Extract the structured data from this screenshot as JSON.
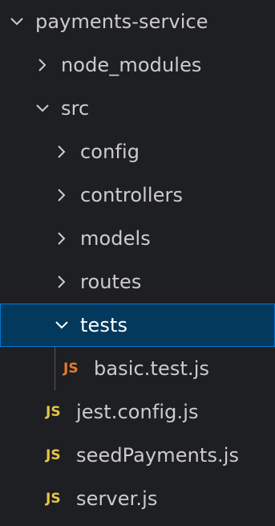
{
  "explorer": {
    "root": {
      "label": "payments-service",
      "expanded": true
    },
    "items": [
      {
        "label": "node_modules",
        "kind": "folder",
        "expanded": false
      },
      {
        "label": "src",
        "kind": "folder",
        "expanded": true
      },
      {
        "label": "config",
        "kind": "folder",
        "expanded": false
      },
      {
        "label": "controllers",
        "kind": "folder",
        "expanded": false
      },
      {
        "label": "models",
        "kind": "folder",
        "expanded": false
      },
      {
        "label": "routes",
        "kind": "folder",
        "expanded": false
      },
      {
        "label": "tests",
        "kind": "folder",
        "expanded": true,
        "selected": true
      },
      {
        "label": "basic.test.js",
        "kind": "file",
        "icon_text": "JS"
      },
      {
        "label": "jest.config.js",
        "kind": "file",
        "icon_text": "JS"
      },
      {
        "label": "seedPayments.js",
        "kind": "file",
        "icon_text": "JS"
      },
      {
        "label": "server.js",
        "kind": "file",
        "icon_text": "JS"
      }
    ]
  },
  "colors": {
    "background": "#1e1f22",
    "text": "#cccccc",
    "selected_bg": "#04395e",
    "selected_border": "#0078d4",
    "js_icon": "#e8c547",
    "test_js_icon": "#e37933"
  },
  "icons": {
    "expanded": "chevron-down-icon",
    "collapsed": "chevron-right-icon",
    "js_file": "javascript-file-icon"
  }
}
